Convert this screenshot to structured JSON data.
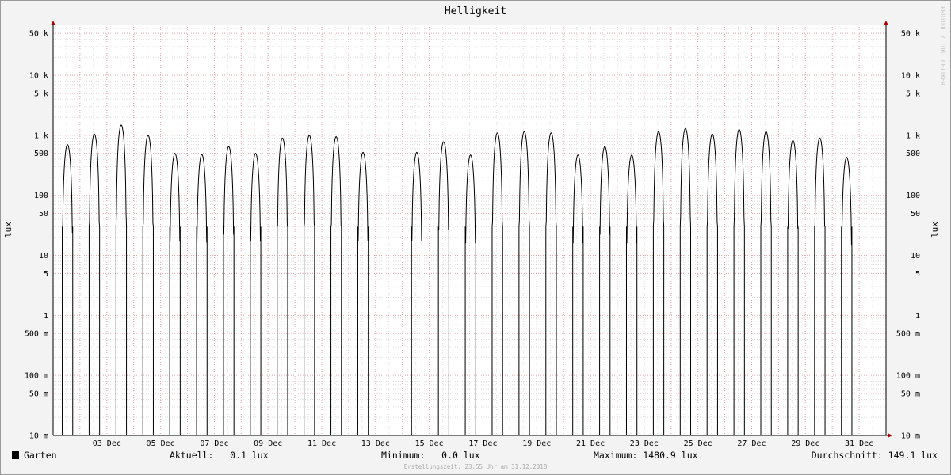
{
  "chart_data": {
    "type": "line",
    "title": "Helligkeit",
    "ylabel": "lux",
    "scale": "log",
    "ylim": [
      0.01,
      70000
    ],
    "xlim_days": [
      1.0,
      32.0
    ],
    "grid": true,
    "y_major_ticks": [
      {
        "value": 0.01,
        "label": "10 m"
      },
      {
        "value": 0.05,
        "label": "50 m"
      },
      {
        "value": 0.1,
        "label": "100 m"
      },
      {
        "value": 0.5,
        "label": "500 m"
      },
      {
        "value": 1,
        "label": "1"
      },
      {
        "value": 5,
        "label": "5"
      },
      {
        "value": 10,
        "label": "10"
      },
      {
        "value": 50,
        "label": "50"
      },
      {
        "value": 100,
        "label": "100"
      },
      {
        "value": 500,
        "label": "500"
      },
      {
        "value": 1000,
        "label": "1 k"
      },
      {
        "value": 5000,
        "label": "5 k"
      },
      {
        "value": 10000,
        "label": "10 k"
      },
      {
        "value": 50000,
        "label": "50 k"
      }
    ],
    "x_ticks": [
      {
        "day": 3,
        "label": "03 Dec"
      },
      {
        "day": 5,
        "label": "05 Dec"
      },
      {
        "day": 7,
        "label": "07 Dec"
      },
      {
        "day": 9,
        "label": "09 Dec"
      },
      {
        "day": 11,
        "label": "11 Dec"
      },
      {
        "day": 13,
        "label": "13 Dec"
      },
      {
        "day": 15,
        "label": "15 Dec"
      },
      {
        "day": 17,
        "label": "17 Dec"
      },
      {
        "day": 19,
        "label": "19 Dec"
      },
      {
        "day": 21,
        "label": "21 Dec"
      },
      {
        "day": 23,
        "label": "23 Dec"
      },
      {
        "day": 25,
        "label": "25 Dec"
      },
      {
        "day": 27,
        "label": "27 Dec"
      },
      {
        "day": 29,
        "label": "29 Dec"
      },
      {
        "day": 31,
        "label": "31 Dec"
      }
    ],
    "series": [
      {
        "name": "Garten",
        "color": "#000000",
        "daily_peaks": [
          {
            "day": 1,
            "peak": 700
          },
          {
            "day": 2,
            "peak": 1050
          },
          {
            "day": 3,
            "peak": 1480
          },
          {
            "day": 4,
            "peak": 1000
          },
          {
            "day": 5,
            "peak": 500
          },
          {
            "day": 6,
            "peak": 480
          },
          {
            "day": 7,
            "peak": 650
          },
          {
            "day": 8,
            "peak": 500
          },
          {
            "day": 9,
            "peak": 900
          },
          {
            "day": 10,
            "peak": 1000
          },
          {
            "day": 11,
            "peak": 950
          },
          {
            "day": 12,
            "peak": 520
          },
          {
            "day": 14,
            "peak": 520
          },
          {
            "day": 15,
            "peak": 780
          },
          {
            "day": 16,
            "peak": 470
          },
          {
            "day": 17,
            "peak": 1100
          },
          {
            "day": 18,
            "peak": 1150
          },
          {
            "day": 19,
            "peak": 1100
          },
          {
            "day": 20,
            "peak": 470
          },
          {
            "day": 21,
            "peak": 650
          },
          {
            "day": 22,
            "peak": 470
          },
          {
            "day": 23,
            "peak": 1150
          },
          {
            "day": 24,
            "peak": 1300
          },
          {
            "day": 25,
            "peak": 1050
          },
          {
            "day": 26,
            "peak": 1250
          },
          {
            "day": 27,
            "peak": 1150
          },
          {
            "day": 28,
            "peak": 820
          },
          {
            "day": 29,
            "peak": 900
          },
          {
            "day": 30,
            "peak": 430
          }
        ]
      }
    ],
    "legend": {
      "name": "Garten",
      "current": "Aktuell:   0.1 lux",
      "minimum": "Minimum:   0.0 lux",
      "maximum": "Maximum: 1480.9 lux",
      "average": "Durchschnitt: 149.1 lux"
    }
  },
  "footer": "Erstellungszeit: 23:55 Uhr am 31.12.2018",
  "watermark": "RRDTOOL / TOBI OETIKER",
  "colors": {
    "background": "#f3f3f3",
    "plot_background": "#ffffff",
    "grid_major": "#e8a6ae",
    "grid_minor": "#d9d9d9",
    "axis_arrow": "#aa0000",
    "line": "#000000"
  }
}
